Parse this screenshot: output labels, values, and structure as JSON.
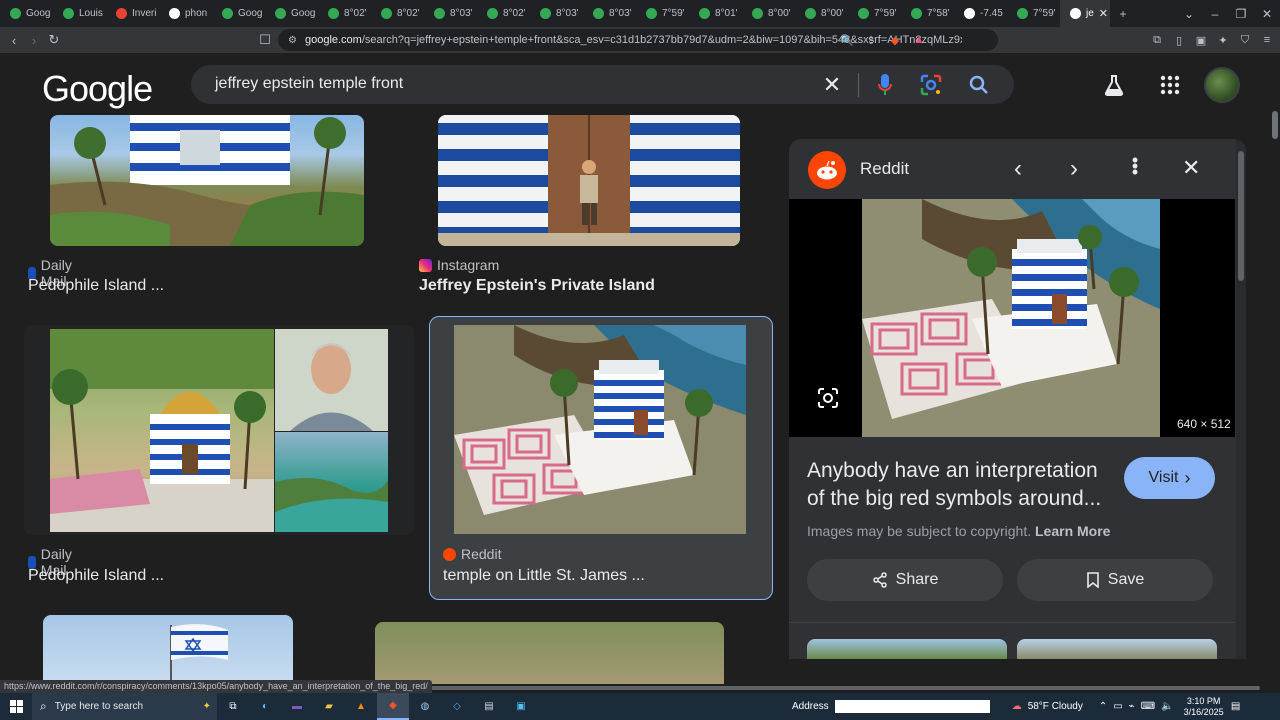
{
  "browser": {
    "tabs": [
      {
        "label": "Goog",
        "color": "#34a853"
      },
      {
        "label": "Louis",
        "color": "#34a853"
      },
      {
        "label": "Inveri",
        "color": "#ea4335"
      },
      {
        "label": "phon",
        "color": "#ffffff"
      },
      {
        "label": "Goog",
        "color": "#34a853"
      },
      {
        "label": "Goog",
        "color": "#34a853"
      },
      {
        "label": "8°02'",
        "color": "#34a853"
      },
      {
        "label": "8°02'",
        "color": "#34a853"
      },
      {
        "label": "8°03'",
        "color": "#34a853"
      },
      {
        "label": "8°02'",
        "color": "#34a853"
      },
      {
        "label": "8°03'",
        "color": "#34a853"
      },
      {
        "label": "8°03'",
        "color": "#34a853"
      },
      {
        "label": "7°59'",
        "color": "#34a853"
      },
      {
        "label": "8°01'",
        "color": "#34a853"
      },
      {
        "label": "8°00'",
        "color": "#34a853"
      },
      {
        "label": "8°00'",
        "color": "#34a853"
      },
      {
        "label": "7°59'",
        "color": "#34a853"
      },
      {
        "label": "7°58'",
        "color": "#34a853"
      },
      {
        "label": "-7.45",
        "color": "#ffffff"
      },
      {
        "label": "7°59'",
        "color": "#34a853"
      },
      {
        "label": "je",
        "color": "#ffffff",
        "active": true
      }
    ],
    "url_host": "google.com",
    "url_rest": "/search?q=jeffrey+epstein+temple+front&sca_esv=c31d1b2737bb79d7&udm=2&biw=1097&bih=548&sxsrf=AHTn8zqMLz9xlCZQ...",
    "status_url": "https://www.reddit.com/r/conspiracy/comments/13kpo05/anybody_have_an_interpretation_of_the_big_red/"
  },
  "google": {
    "logo": "Google",
    "query": "jeffrey epstein temple front"
  },
  "results": [
    {
      "source": "Daily Mail",
      "title": "Pedophile Island ...",
      "badge_color": "#1a4fb5"
    },
    {
      "source": "Instagram",
      "title": "Jeffrey Epstein's Private Island",
      "badge_color": "#d6249f"
    },
    {
      "source": "Daily Mail",
      "title": "Pedophile Island ...",
      "badge_color": "#1a4fb5"
    },
    {
      "source": "Reddit",
      "title": "temple on Little St. James ...",
      "badge_color": "#ff4500"
    }
  ],
  "panel": {
    "source": "Reddit",
    "dimensions": "640 × 512",
    "title": "Anybody have an interpretation of the big red symbols around...",
    "visit_label": "Visit",
    "copyright": "Images may be subject to copyright.",
    "learn_more": "Learn More",
    "share_label": "Share",
    "save_label": "Save"
  },
  "taskbar": {
    "search_placeholder": "Type here to search",
    "address_label": "Address",
    "weather": "58°F  Cloudy",
    "time": "3:10 PM",
    "date": "3/16/2025"
  },
  "colors": {
    "accent": "#8ab4f8",
    "visit_bg": "#8ab4f8",
    "panel_bg": "#303134",
    "page_bg": "#1f1f1f"
  }
}
